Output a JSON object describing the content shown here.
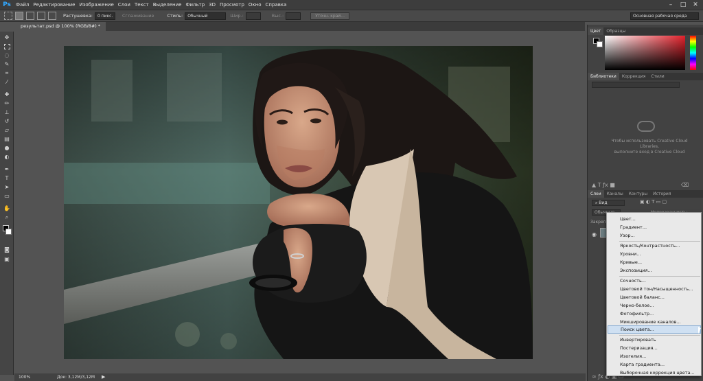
{
  "app": {
    "logo": "Ps"
  },
  "menu": [
    "Файл",
    "Редактирование",
    "Изображение",
    "Слои",
    "Текст",
    "Выделение",
    "Фильтр",
    "3D",
    "Просмотр",
    "Окно",
    "Справка"
  ],
  "window_controls": {
    "minimize": "–",
    "restore": "□",
    "close": "✕"
  },
  "options_bar": {
    "feather_label": "Растушевка:",
    "feather_value": "0 пикс.",
    "antialias_label": "Сглаживание",
    "style_label": "Стиль:",
    "style_value": "Обычный",
    "width_label": "Шир.:",
    "height_label": "Выс.:",
    "refine_button": "Уточн. край...",
    "workspace": "Основная рабочая среда"
  },
  "document": {
    "tab_title": "результат.psd @ 100% (RGB/8#) *",
    "zoom": "100%",
    "doc_size": "Док: 3,12M/3,12M"
  },
  "panels": {
    "color_tabs": [
      "Цвет",
      "Образцы"
    ],
    "libraries_tabs": [
      "Библиотеки",
      "Коррекция",
      "Стили"
    ],
    "cc_message_line1": "Чтобы использовать Creative Cloud",
    "cc_message_line2": "Libraries,",
    "cc_message_line3": "выполните вход в Creative Cloud",
    "layers_tabs": [
      "Слои",
      "Каналы",
      "Контуры",
      "История"
    ],
    "layer_filter": "Вид",
    "blend_mode": "Обычные",
    "opacity_label": "Непрозрачность:",
    "lock_label": "Закрепить:"
  },
  "context_menu": {
    "group1": [
      "Цвет...",
      "Градиент...",
      "Узор..."
    ],
    "group2": [
      "Яркость/Контрастность...",
      "Уровни...",
      "Кривые...",
      "Экспозиция..."
    ],
    "group3": [
      "Сочность...",
      "Цветовой тон/Насыщенность...",
      "Цветовой баланс...",
      "Черно-белое...",
      "Фотофильтр...",
      "Микширование каналов...",
      "Поиск цвета..."
    ],
    "group4": [
      "Инвертировать",
      "Постеризация...",
      "Изогелия...",
      "Карта градиента...",
      "Выборочная коррекция цвета..."
    ],
    "highlighted": "Поиск цвета..."
  },
  "colors": {
    "accent_blue": "#31a8ff",
    "menu_highlight": "#cfe0f2",
    "panel_bg": "#424242",
    "canvas_bg": "#535353"
  }
}
